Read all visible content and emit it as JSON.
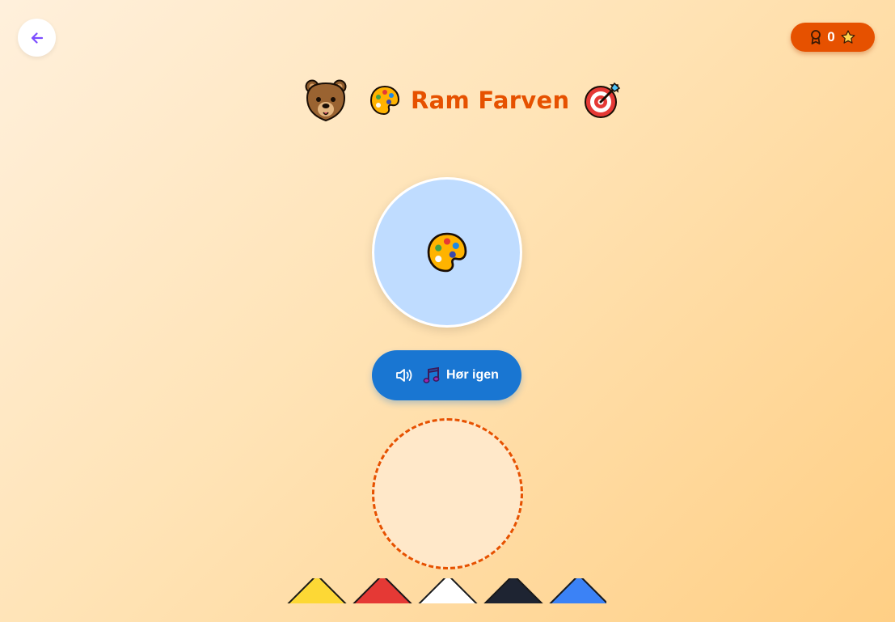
{
  "header": {
    "back_icon": "arrow-left-icon",
    "score": {
      "value": "0",
      "badge_icon": "award-icon",
      "star_icon": "star-icon"
    }
  },
  "title": {
    "text": "Ram Farven",
    "left_icon": "bear-face-emoji",
    "palette_icon": "artist-palette-emoji",
    "right_icon": "direct-hit-emoji"
  },
  "prompt": {
    "icon": "artist-palette-emoji",
    "background_color": "#bfdcff"
  },
  "replay_button": {
    "label": "Hør igen",
    "speaker_icon": "volume-icon",
    "music_icon": "musical-notes-emoji"
  },
  "drop_zone": {
    "border_color": "#e65100"
  },
  "color_options": [
    {
      "name": "yellow",
      "color": "#fdd835"
    },
    {
      "name": "red",
      "color": "#e53935"
    },
    {
      "name": "white",
      "color": "#ffffff"
    },
    {
      "name": "black",
      "color": "#1e2432"
    },
    {
      "name": "blue",
      "color": "#3b82f6"
    }
  ],
  "colors": {
    "accent": "#e65100",
    "primary_button": "#1976d2",
    "back_arrow": "#7c4dff"
  }
}
